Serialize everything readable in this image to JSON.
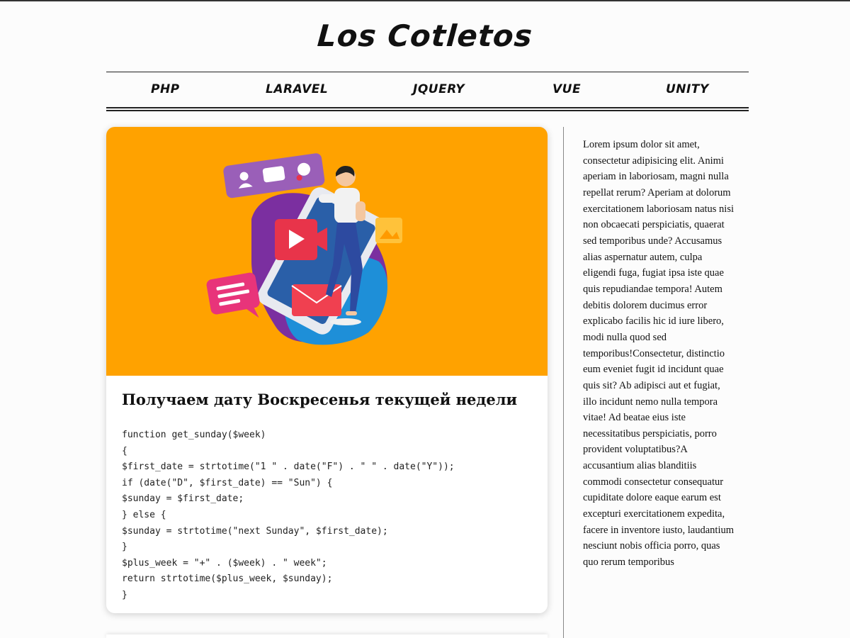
{
  "site": {
    "title": "Los Cotletos"
  },
  "nav": {
    "items": [
      {
        "label": "PHP"
      },
      {
        "label": "LARAVEL"
      },
      {
        "label": "JQUERY"
      },
      {
        "label": "VUE"
      },
      {
        "label": "UNITY"
      }
    ]
  },
  "post": {
    "title": "Получаем дату Воскресенья текущей недели",
    "code_lines": [
      "function get_sunday($week)",
      "{",
      "$first_date = strtotime(\"1 \" . date(\"F\") . \" \" . date(\"Y\"));",
      "if (date(\"D\", $first_date) == \"Sun\") {",
      "$sunday = $first_date;",
      "} else {",
      "$sunday = strtotime(\"next Sunday\", $first_date);",
      "}",
      "$plus_week = \"+\" . ($week) . \" week\";",
      "return strtotime($plus_week, $sunday);",
      "}"
    ],
    "hero_color": "#ffa200"
  },
  "sidebar": {
    "text": "Lorem ipsum dolor sit amet, consectetur adipisicing elit. Animi aperiam in laboriosam, magni nulla repellat rerum? Aperiam at dolorum exercitationem laboriosam natus nisi non obcaecati perspiciatis, quaerat sed temporibus unde? Accusamus alias aspernatur autem, culpa eligendi fuga, fugiat ipsa iste quae quis repudiandae tempora! Autem debitis dolorem ducimus error explicabo facilis hic id iure libero, modi nulla quod sed temporibus!Consectetur, distinctio eum eveniet fugit id incidunt quae quis sit? Ab adipisci aut et fugiat, illo incidunt nemo nulla tempora vitae! Ad beatae eius iste necessitatibus perspiciatis, porro provident voluptatibus?A accusantium alias blanditiis commodi consectetur consequatur cupiditate dolore eaque earum est excepturi exercitationem expedita, facere in inventore iusto, laudantium nesciunt nobis officia porro, quas quo rerum temporibus"
  }
}
